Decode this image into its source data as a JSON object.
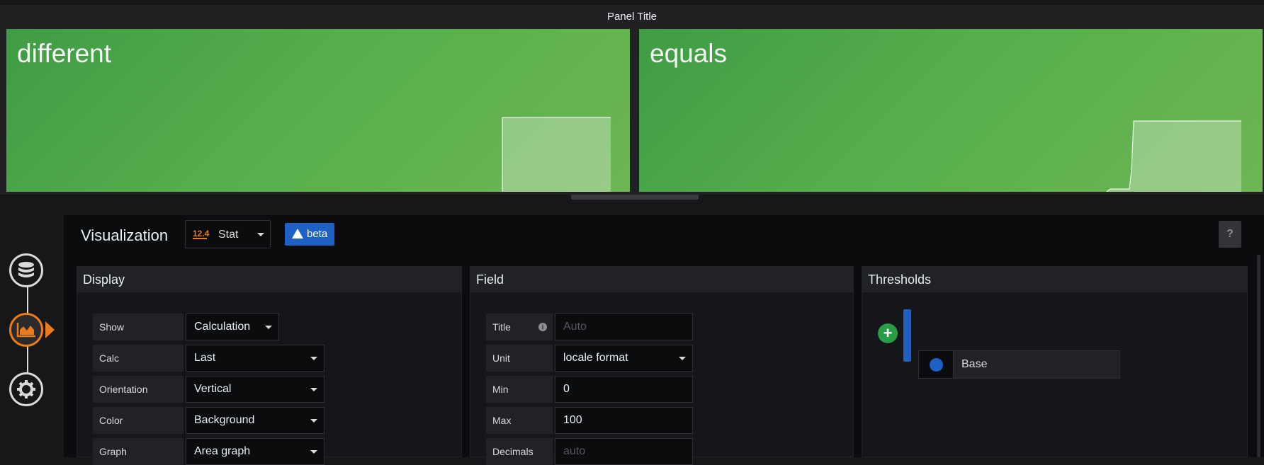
{
  "panel": {
    "title": "Panel Title",
    "stats": [
      {
        "label": "different",
        "sparkline_fraction": 0.58
      },
      {
        "label": "equals",
        "sparkline_fraction": 0.55
      }
    ]
  },
  "sidebar": {
    "items": [
      {
        "name": "queries",
        "icon": "database-icon",
        "active": false
      },
      {
        "name": "visualization",
        "icon": "chart-area-icon",
        "active": true
      },
      {
        "name": "general",
        "icon": "gear-icon",
        "active": false
      }
    ]
  },
  "editor": {
    "visualization_label": "Visualization",
    "viz_type": "Stat",
    "viz_icon_text": "12.4",
    "beta_label": "beta",
    "help_label": "?",
    "display": {
      "title": "Display",
      "rows": [
        {
          "label": "Show",
          "value": "Calculation"
        },
        {
          "label": "Calc",
          "value": "Last"
        },
        {
          "label": "Orientation",
          "value": "Vertical"
        },
        {
          "label": "Color",
          "value": "Background"
        },
        {
          "label": "Graph",
          "value": "Area graph"
        }
      ]
    },
    "field": {
      "title": "Field",
      "rows": [
        {
          "label": "Title",
          "value": "",
          "placeholder": "Auto"
        },
        {
          "label": "Unit",
          "value": "locale format"
        },
        {
          "label": "Min",
          "value": "0"
        },
        {
          "label": "Max",
          "value": "100"
        },
        {
          "label": "Decimals",
          "value": "",
          "placeholder": "auto"
        }
      ]
    },
    "thresholds": {
      "title": "Thresholds",
      "add_label": "+",
      "base_label": "Base",
      "base_color": "#1f60c4"
    }
  },
  "colors": {
    "stat_green": "#56ae4c",
    "accent_orange": "#eb7b18",
    "primary_blue": "#1f60c4",
    "add_green": "#299c46"
  }
}
